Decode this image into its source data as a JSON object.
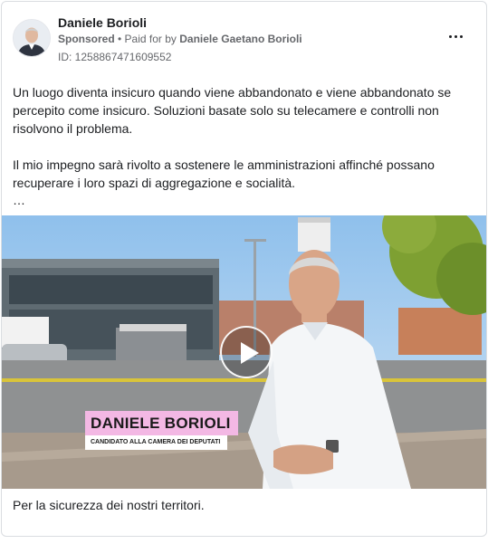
{
  "ad": {
    "author": "Daniele Borioli",
    "sponsored_label": "Sponsored",
    "paid_for_prefix": " • Paid for by ",
    "paid_for_by": "Daniele Gaetano Borioli",
    "id_text": "ID: 1258867471609552",
    "body_paragraphs": [
      "Un luogo diventa insicuro quando viene abbandonato e viene abbandonato se percepito come insicuro. Soluzioni basate solo su telecamere e controlli non risolvono il problema.",
      "Il mio impegno sarà rivolto a sostenere le amministrazioni affinché possano recuperare i loro spazi di aggregazione e socialità."
    ],
    "ellipsis": "…",
    "video": {
      "name_overlay": "DANIELE BORIOLI",
      "role_overlay": "CANDIDATO ALLA CAMERA DEI DEPUTATI"
    },
    "caption": "Per la sicurezza dei nostri territori."
  },
  "colors": {
    "text_primary": "#1c1e21",
    "text_secondary": "#65676b",
    "border": "#dadde1",
    "name_plate": "#f3b8e4"
  },
  "icons": {
    "more": "more-horizontal-icon",
    "play": "play-icon"
  }
}
